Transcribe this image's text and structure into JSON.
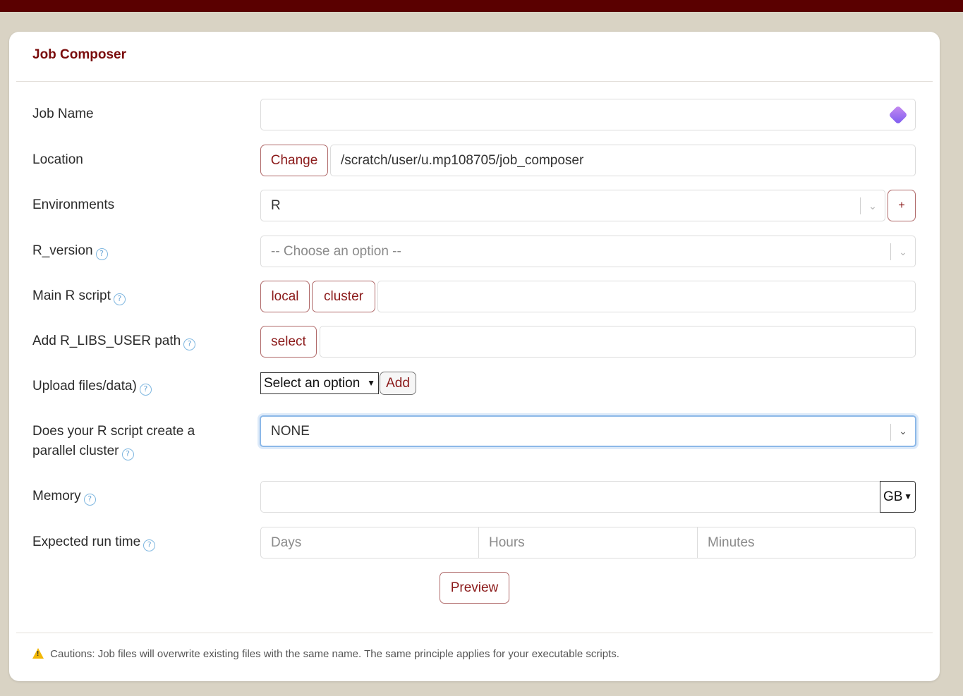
{
  "card_title": "Job Composer",
  "fields": {
    "job_name": {
      "label": "Job Name",
      "value": ""
    },
    "location": {
      "label": "Location",
      "button": "Change",
      "value": "/scratch/user/u.mp108705/job_composer"
    },
    "environments": {
      "label": "Environments",
      "value": "R",
      "add_label": "+"
    },
    "r_version": {
      "label": "R_version",
      "placeholder": "-- Choose an option --"
    },
    "main_script": {
      "label": "Main R script",
      "local_label": "local",
      "cluster_label": "cluster",
      "value": ""
    },
    "r_libs": {
      "label": "Add R_LIBS_USER path",
      "button": "select",
      "value": ""
    },
    "upload": {
      "label": "Upload files/data)",
      "selected": "Select an option",
      "add_label": "Add"
    },
    "parallel": {
      "label_line1": "Does your R script create a",
      "label_line2": "parallel cluster",
      "value": "NONE"
    },
    "memory": {
      "label": "Memory",
      "value": "",
      "unit": "GB"
    },
    "runtime": {
      "label": "Expected run time",
      "days_placeholder": "Days",
      "hours_placeholder": "Hours",
      "minutes_placeholder": "Minutes"
    }
  },
  "preview_label": "Preview",
  "caution_text": "Cautions: Job files will overwrite existing files with the same name. The same principle applies for your executable scripts.",
  "colors": {
    "topbar": "#5a0000",
    "accent": "#8b1a1a",
    "background": "#d9d3c4"
  }
}
